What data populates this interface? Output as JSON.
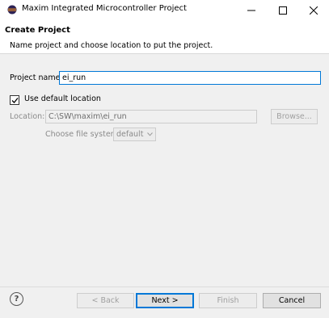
{
  "window": {
    "title": "Maxim Integrated Microcontroller Project",
    "icon": "eclipse-icon",
    "controls": [
      "minimize-icon",
      "maximize-icon",
      "close-icon"
    ]
  },
  "header": {
    "title": "Create Project",
    "message": "Name project and choose location to put the project."
  },
  "form": {
    "project_name_label": "Project name:",
    "project_name_value": "ei_run",
    "use_default_location_label": "Use default location",
    "use_default_location_checked": true,
    "location_label": "Location:",
    "location_value": "C:\\SW\\maxim\\ei_run",
    "browse_label": "Browse...",
    "file_system_label": "Choose file system:",
    "file_system_value": "default"
  },
  "footer": {
    "back_label": "< Back",
    "next_label": "Next >",
    "finish_label": "Finish",
    "cancel_label": "Cancel",
    "help_icon": "help-icon"
  },
  "colors": {
    "accent": "#0078d7",
    "dialog_background": "#f0f0f0"
  }
}
